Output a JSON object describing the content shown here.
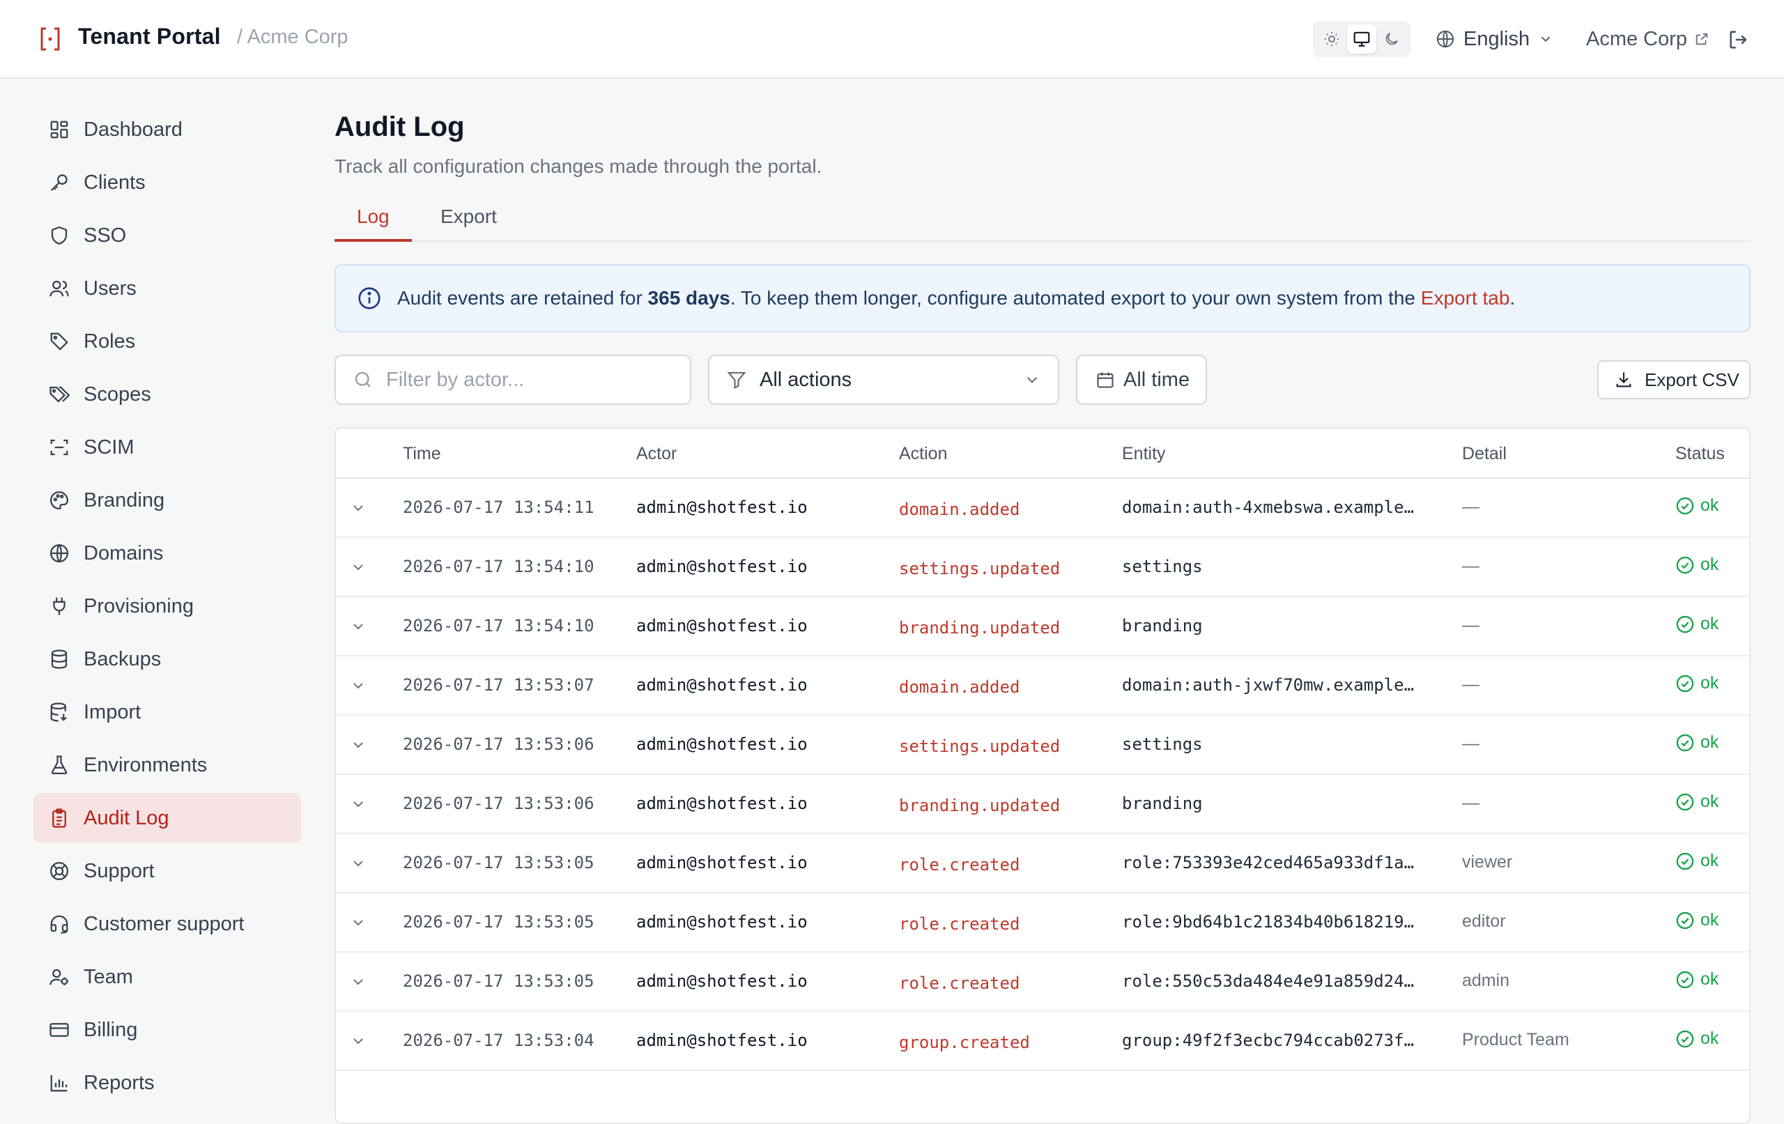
{
  "header": {
    "title": "Tenant Portal",
    "tenant_crumb": "/ Acme Corp",
    "language": "English",
    "tenant_link": "Acme Corp",
    "accent": "#c0392b"
  },
  "sidebar": {
    "items": [
      {
        "label": "Dashboard",
        "icon": "dashboard-icon"
      },
      {
        "label": "Clients",
        "icon": "key-icon"
      },
      {
        "label": "SSO",
        "icon": "shield-icon"
      },
      {
        "label": "Users",
        "icon": "users-icon"
      },
      {
        "label": "Roles",
        "icon": "tag-icon"
      },
      {
        "label": "Scopes",
        "icon": "tags-icon"
      },
      {
        "label": "SCIM",
        "icon": "scan-icon"
      },
      {
        "label": "Branding",
        "icon": "palette-icon"
      },
      {
        "label": "Domains",
        "icon": "globe-icon"
      },
      {
        "label": "Provisioning",
        "icon": "plug-icon"
      },
      {
        "label": "Backups",
        "icon": "database-icon"
      },
      {
        "label": "Import",
        "icon": "database-import-icon"
      },
      {
        "label": "Environments",
        "icon": "flask-icon"
      },
      {
        "label": "Audit Log",
        "icon": "clipboard-icon",
        "active": true
      },
      {
        "label": "Support",
        "icon": "lifebuoy-icon"
      },
      {
        "label": "Customer support",
        "icon": "headset-icon"
      },
      {
        "label": "Team",
        "icon": "team-icon"
      },
      {
        "label": "Billing",
        "icon": "credit-card-icon"
      },
      {
        "label": "Reports",
        "icon": "bar-chart-icon"
      }
    ]
  },
  "main": {
    "title": "Audit Log",
    "subtitle": "Track all configuration changes made through the portal.",
    "tabs": [
      {
        "label": "Log",
        "active": true
      },
      {
        "label": "Export"
      }
    ],
    "banner": {
      "prefix": "Audit events are retained for ",
      "emphasis": "365 days",
      "middle": ". To keep them longer, configure automated export to your own system from the ",
      "link": "Export tab",
      "suffix": "."
    },
    "filters": {
      "search_placeholder": "Filter by actor...",
      "action_value": "All actions",
      "time_value": "All time",
      "export_label": "Export CSV"
    },
    "table": {
      "headers": [
        "Time",
        "Actor",
        "Action",
        "Entity",
        "Detail",
        "Status"
      ],
      "rows": [
        {
          "time": "2026-07-17 13:54:11",
          "actor": "admin@shotfest.io",
          "action": "domain.added",
          "entity": "domain:auth-4xmebswa.example.…",
          "detail": "—",
          "status": "ok"
        },
        {
          "time": "2026-07-17 13:54:10",
          "actor": "admin@shotfest.io",
          "action": "settings.updated",
          "entity": "settings",
          "detail": "—",
          "status": "ok"
        },
        {
          "time": "2026-07-17 13:54:10",
          "actor": "admin@shotfest.io",
          "action": "branding.updated",
          "entity": "branding",
          "detail": "—",
          "status": "ok"
        },
        {
          "time": "2026-07-17 13:53:07",
          "actor": "admin@shotfest.io",
          "action": "domain.added",
          "entity": "domain:auth-jxwf70mw.example.…",
          "detail": "—",
          "status": "ok"
        },
        {
          "time": "2026-07-17 13:53:06",
          "actor": "admin@shotfest.io",
          "action": "settings.updated",
          "entity": "settings",
          "detail": "—",
          "status": "ok"
        },
        {
          "time": "2026-07-17 13:53:06",
          "actor": "admin@shotfest.io",
          "action": "branding.updated",
          "entity": "branding",
          "detail": "—",
          "status": "ok"
        },
        {
          "time": "2026-07-17 13:53:05",
          "actor": "admin@shotfest.io",
          "action": "role.created",
          "entity": "role:753393e42ced465a933df1a9…",
          "detail": "viewer",
          "status": "ok"
        },
        {
          "time": "2026-07-17 13:53:05",
          "actor": "admin@shotfest.io",
          "action": "role.created",
          "entity": "role:9bd64b1c21834b40b6182196…",
          "detail": "editor",
          "status": "ok"
        },
        {
          "time": "2026-07-17 13:53:05",
          "actor": "admin@shotfest.io",
          "action": "role.created",
          "entity": "role:550c53da484e4e91a859d24b…",
          "detail": "admin",
          "status": "ok"
        },
        {
          "time": "2026-07-17 13:53:04",
          "actor": "admin@shotfest.io",
          "action": "group.created",
          "entity": "group:49f2f3ecbc794ccab0273fe…",
          "detail": "Product Team",
          "status": "ok"
        }
      ]
    }
  }
}
